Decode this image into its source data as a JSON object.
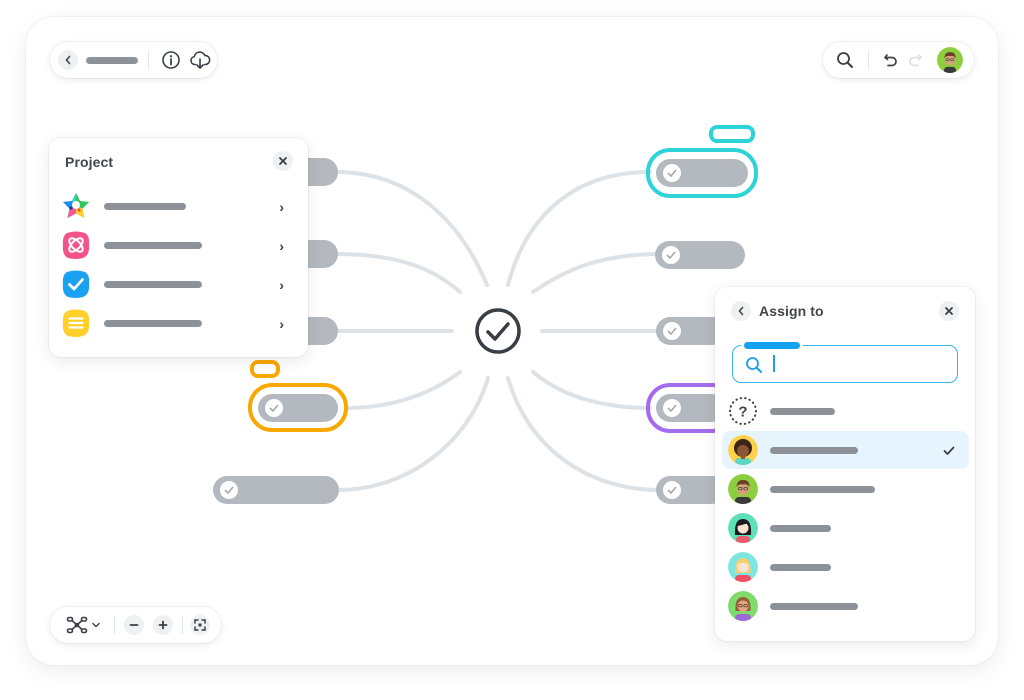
{
  "top_left_toolbar": {
    "back_icon": "chevron-left-icon",
    "title_placeholder": "",
    "info_icon": "info-icon",
    "download_icon": "cloud-download-icon"
  },
  "top_right_toolbar": {
    "search_icon": "search-icon",
    "undo_icon": "undo-icon",
    "redo_icon": "redo-icon",
    "user_avatar": "avatar-man-glasses-green"
  },
  "bottom_toolbar": {
    "layout_icon": "mindmap-layout-icon",
    "layout_dropdown_icon": "chevron-down-icon",
    "zoom_out_label": "−",
    "zoom_in_label": "+",
    "fit_icon": "fit-screen-icon"
  },
  "mindmap": {
    "center_icon": "check-circle-icon",
    "left_nodes": [
      {
        "highlight": null
      },
      {
        "highlight": null
      },
      {
        "highlight": null
      },
      {
        "highlight": "orange",
        "has_tag": true
      },
      {
        "highlight": null
      }
    ],
    "right_nodes": [
      {
        "highlight": "teal",
        "has_tag": true
      },
      {
        "highlight": null
      },
      {
        "highlight": null
      },
      {
        "highlight": "purple"
      },
      {
        "highlight": null
      }
    ],
    "colors": {
      "node": "#b3b9be",
      "connector": "#dde2e6",
      "orange": "#f9a800",
      "teal": "#2ed3d8",
      "purple": "#a36cf0",
      "center": "#383e44"
    }
  },
  "project_panel": {
    "title": "Project",
    "close_icon": "close-icon",
    "items": [
      {
        "icon": "star-multicolor-icon",
        "chevron": "›"
      },
      {
        "icon": "pink-atom-app-icon",
        "chevron": "›"
      },
      {
        "icon": "blue-check-app-icon",
        "chevron": "›"
      },
      {
        "icon": "yellow-lines-app-icon",
        "chevron": "›"
      }
    ]
  },
  "assign_panel": {
    "title": "Assign to",
    "back_icon": "chevron-left-icon",
    "close_icon": "close-icon",
    "search": {
      "value": "",
      "placeholder": "",
      "icon": "search-icon"
    },
    "people": [
      {
        "avatar": "unassigned-question-icon",
        "selected": false
      },
      {
        "avatar": "avatar-curly-hair-yellow",
        "selected": true
      },
      {
        "avatar": "avatar-man-glasses-green",
        "selected": false
      },
      {
        "avatar": "avatar-black-hair-teal",
        "selected": false
      },
      {
        "avatar": "avatar-blonde-teal",
        "selected": false
      },
      {
        "avatar": "avatar-brown-hair-glasses-green",
        "selected": false
      }
    ],
    "selected_mark": "✓"
  }
}
